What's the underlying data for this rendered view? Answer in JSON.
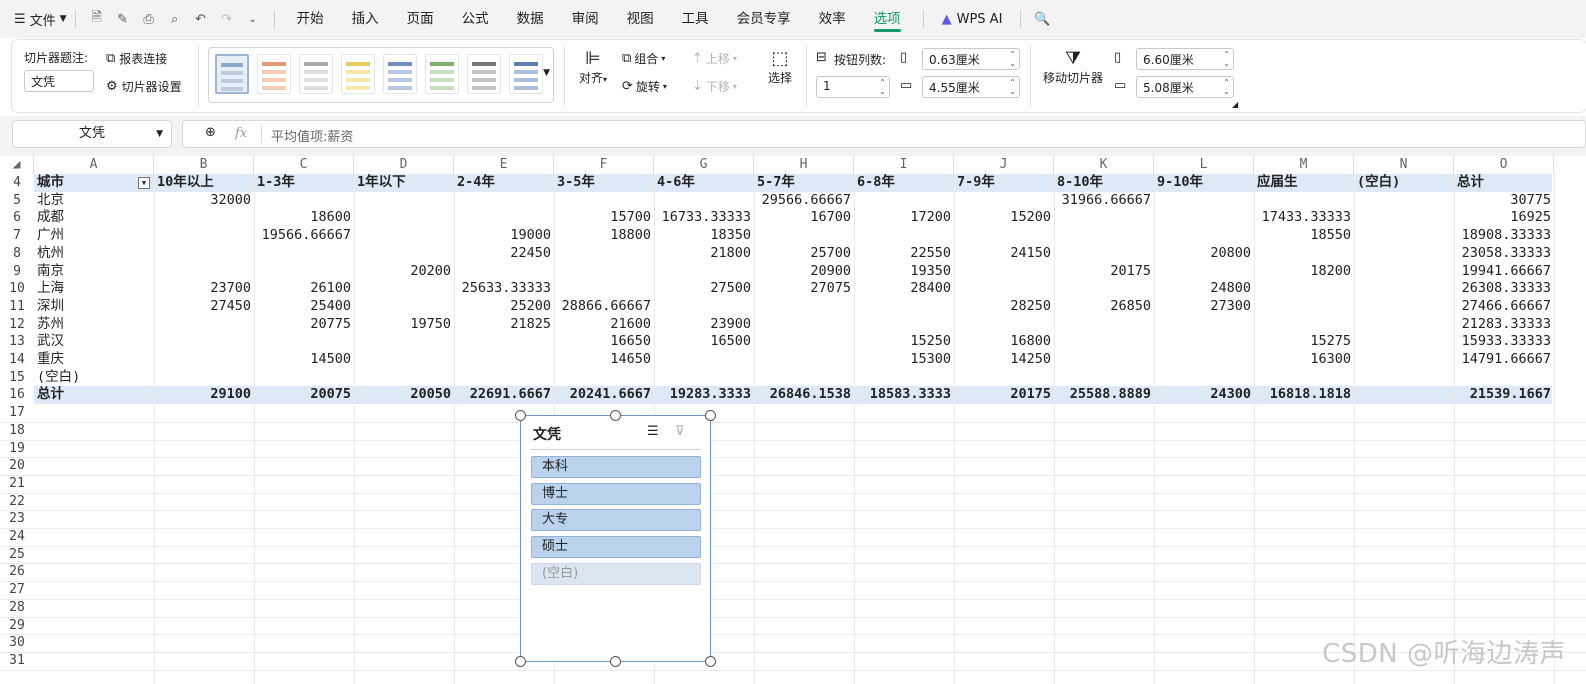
{
  "menubar": {
    "file": "文件",
    "tabs": [
      "开始",
      "插入",
      "页面",
      "公式",
      "数据",
      "审阅",
      "视图",
      "工具",
      "会员专享",
      "效率",
      "选项"
    ],
    "active_tab": "选项",
    "ai": "WPS AI"
  },
  "ribbon": {
    "caption_label": "切片器题注:",
    "caption_value": "文凭",
    "report_conn": "报表连接",
    "slicer_settings": "切片器设置",
    "align": "对齐",
    "group": "组合",
    "rotate": "旋转",
    "bring_fwd": "上移",
    "send_back": "下移",
    "select": "选择",
    "btn_cols_label": "按钮列数:",
    "btn_cols_value": "1",
    "btn_height": "0.63厘米",
    "btn_width": "4.55厘米",
    "move_slicer": "移动切片器",
    "slicer_height": "6.60厘米",
    "slicer_width": "5.08厘米"
  },
  "formula": {
    "namebox": "文凭",
    "fx": "fx",
    "content": "平均值项:薪资"
  },
  "grid": {
    "columns": [
      "A",
      "B",
      "C",
      "D",
      "E",
      "F",
      "G",
      "H",
      "I",
      "J",
      "K",
      "L",
      "M",
      "N",
      "O"
    ],
    "header_row": {
      "num": "4",
      "cells": [
        "城市",
        "10年以上",
        "1-3年",
        "1年以下",
        "2-4年",
        "3-5年",
        "4-6年",
        "5-7年",
        "6-8年",
        "7-9年",
        "8-10年",
        "9-10年",
        "应届生",
        "(空白)",
        "总计"
      ]
    },
    "rows": [
      {
        "num": "5",
        "cells": [
          "北京",
          "32000",
          "",
          "",
          "",
          "",
          "",
          "29566.66667",
          "",
          "",
          "31966.66667",
          "",
          "",
          "",
          "30775"
        ]
      },
      {
        "num": "6",
        "cells": [
          "成都",
          "",
          "18600",
          "",
          "",
          "15700",
          "16733.33333",
          "16700",
          "17200",
          "15200",
          "",
          "",
          "17433.33333",
          "",
          "16925"
        ]
      },
      {
        "num": "7",
        "cells": [
          "广州",
          "",
          "19566.66667",
          "",
          "19000",
          "18800",
          "18350",
          "",
          "",
          "",
          "",
          "",
          "18550",
          "",
          "18908.33333"
        ]
      },
      {
        "num": "8",
        "cells": [
          "杭州",
          "",
          "",
          "",
          "22450",
          "",
          "21800",
          "25700",
          "22550",
          "24150",
          "",
          "20800",
          "",
          "",
          "23058.33333"
        ]
      },
      {
        "num": "9",
        "cells": [
          "南京",
          "",
          "",
          "20200",
          "",
          "",
          "",
          "20900",
          "19350",
          "",
          "20175",
          "",
          "18200",
          "",
          "19941.66667"
        ]
      },
      {
        "num": "10",
        "cells": [
          "上海",
          "23700",
          "26100",
          "",
          "25633.33333",
          "",
          "27500",
          "27075",
          "28400",
          "",
          "",
          "24800",
          "",
          "",
          "26308.33333"
        ]
      },
      {
        "num": "11",
        "cells": [
          "深圳",
          "27450",
          "25400",
          "",
          "25200",
          "28866.66667",
          "",
          "",
          "",
          "28250",
          "26850",
          "27300",
          "",
          "",
          "27466.66667"
        ]
      },
      {
        "num": "12",
        "cells": [
          "苏州",
          "",
          "20775",
          "19750",
          "21825",
          "21600",
          "23900",
          "",
          "",
          "",
          "",
          "",
          "",
          "",
          "21283.33333"
        ]
      },
      {
        "num": "13",
        "cells": [
          "武汉",
          "",
          "",
          "",
          "",
          "16650",
          "16500",
          "",
          "15250",
          "16800",
          "",
          "",
          "15275",
          "",
          "15933.33333"
        ]
      },
      {
        "num": "14",
        "cells": [
          "重庆",
          "",
          "14500",
          "",
          "",
          "14650",
          "",
          "",
          "15300",
          "14250",
          "",
          "",
          "16300",
          "",
          "14791.66667"
        ]
      },
      {
        "num": "15",
        "cells": [
          "(空白)",
          "",
          "",
          "",
          "",
          "",
          "",
          "",
          "",
          "",
          "",
          "",
          "",
          "",
          ""
        ]
      }
    ],
    "total_row": {
      "num": "16",
      "cells": [
        "总计",
        "29100",
        "20075",
        "20050",
        "22691.6667",
        "20241.6667",
        "19283.3333",
        "26846.1538",
        "18583.3333",
        "20175",
        "25588.8889",
        "24300",
        "16818.1818",
        "",
        "21539.1667"
      ]
    },
    "empty_rows": [
      "17",
      "18",
      "19",
      "20",
      "21",
      "22",
      "23",
      "24",
      "25",
      "26",
      "27",
      "28",
      "29",
      "30",
      "31"
    ]
  },
  "slicer": {
    "title": "文凭",
    "items": [
      {
        "label": "本科",
        "selected": true
      },
      {
        "label": "博士",
        "selected": true
      },
      {
        "label": "大专",
        "selected": true
      },
      {
        "label": "硕士",
        "selected": true
      },
      {
        "label": "(空白)",
        "selected": false
      }
    ]
  },
  "watermark": "CSDN @听海边涛声"
}
